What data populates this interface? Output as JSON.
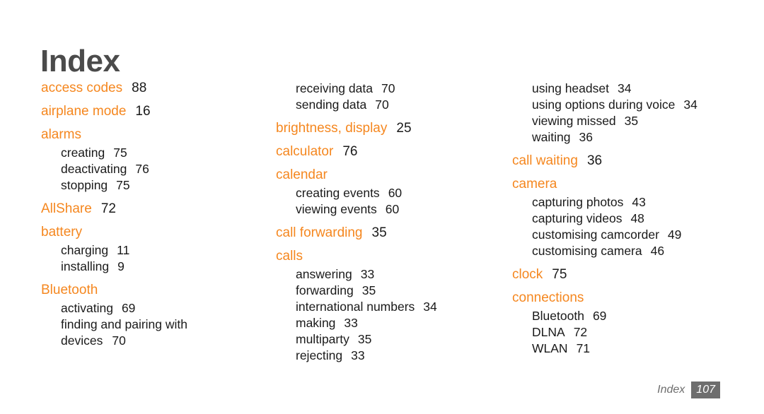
{
  "document": {
    "title": "Index",
    "accent_color": "#f5871f",
    "title_color": "#4b4b4b",
    "text_color": "#1a1a1a",
    "footer_color": "#6e6e6e",
    "background_color": "#ffffff"
  },
  "footer": {
    "label": "Index",
    "page_number": "107"
  },
  "columns": [
    {
      "id": "column-1",
      "entries": [
        {
          "level": "main",
          "label": "access codes",
          "page": "88"
        },
        {
          "level": "main",
          "label": "airplane mode",
          "page": "16"
        },
        {
          "level": "main",
          "label": "alarms",
          "page": ""
        },
        {
          "level": "sub",
          "label": "creating",
          "page": "75"
        },
        {
          "level": "sub",
          "label": "deactivating",
          "page": "76"
        },
        {
          "level": "sub",
          "label": "stopping",
          "page": "75"
        },
        {
          "level": "main",
          "label": "AllShare",
          "page": "72"
        },
        {
          "level": "main",
          "label": "battery",
          "page": ""
        },
        {
          "level": "sub",
          "label": "charging",
          "page": "11"
        },
        {
          "level": "sub",
          "label": "installing",
          "page": "9"
        },
        {
          "level": "main",
          "label": "Bluetooth",
          "page": ""
        },
        {
          "level": "sub",
          "label": "activating",
          "page": "69"
        },
        {
          "level": "sub",
          "label": "finding and pairing with",
          "page": ""
        },
        {
          "level": "cont",
          "label": "devices",
          "page": "70"
        }
      ]
    },
    {
      "id": "column-2",
      "entries": [
        {
          "level": "sub",
          "label": "receiving data",
          "page": "70"
        },
        {
          "level": "sub",
          "label": "sending data",
          "page": "70"
        },
        {
          "level": "main",
          "label": "brightness, display",
          "page": "25"
        },
        {
          "level": "main",
          "label": "calculator",
          "page": "76"
        },
        {
          "level": "main",
          "label": "calendar",
          "page": ""
        },
        {
          "level": "sub",
          "label": "creating events",
          "page": "60"
        },
        {
          "level": "sub",
          "label": "viewing events",
          "page": "60"
        },
        {
          "level": "main",
          "label": "call forwarding",
          "page": "35"
        },
        {
          "level": "main",
          "label": "calls",
          "page": ""
        },
        {
          "level": "sub",
          "label": "answering",
          "page": "33"
        },
        {
          "level": "sub",
          "label": "forwarding",
          "page": "35"
        },
        {
          "level": "sub",
          "label": "international numbers",
          "page": "34"
        },
        {
          "level": "sub",
          "label": "making",
          "page": "33"
        },
        {
          "level": "sub",
          "label": "multiparty",
          "page": "35"
        },
        {
          "level": "sub",
          "label": "rejecting",
          "page": "33"
        }
      ]
    },
    {
      "id": "column-3",
      "entries": [
        {
          "level": "sub",
          "label": "using headset",
          "page": "34"
        },
        {
          "level": "sub",
          "label": "using options during voice",
          "page": "34"
        },
        {
          "level": "sub",
          "label": "viewing missed",
          "page": "35"
        },
        {
          "level": "sub",
          "label": "waiting",
          "page": "36"
        },
        {
          "level": "main",
          "label": "call waiting",
          "page": "36"
        },
        {
          "level": "main",
          "label": "camera",
          "page": ""
        },
        {
          "level": "sub",
          "label": "capturing photos",
          "page": "43"
        },
        {
          "level": "sub",
          "label": "capturing videos",
          "page": "48"
        },
        {
          "level": "sub",
          "label": "customising camcorder",
          "page": "49"
        },
        {
          "level": "sub",
          "label": "customising camera",
          "page": "46"
        },
        {
          "level": "main",
          "label": "clock",
          "page": "75"
        },
        {
          "level": "main",
          "label": "connections",
          "page": ""
        },
        {
          "level": "sub",
          "label": "Bluetooth",
          "page": "69"
        },
        {
          "level": "sub",
          "label": "DLNA",
          "page": "72"
        },
        {
          "level": "sub",
          "label": "WLAN",
          "page": "71"
        }
      ]
    }
  ]
}
